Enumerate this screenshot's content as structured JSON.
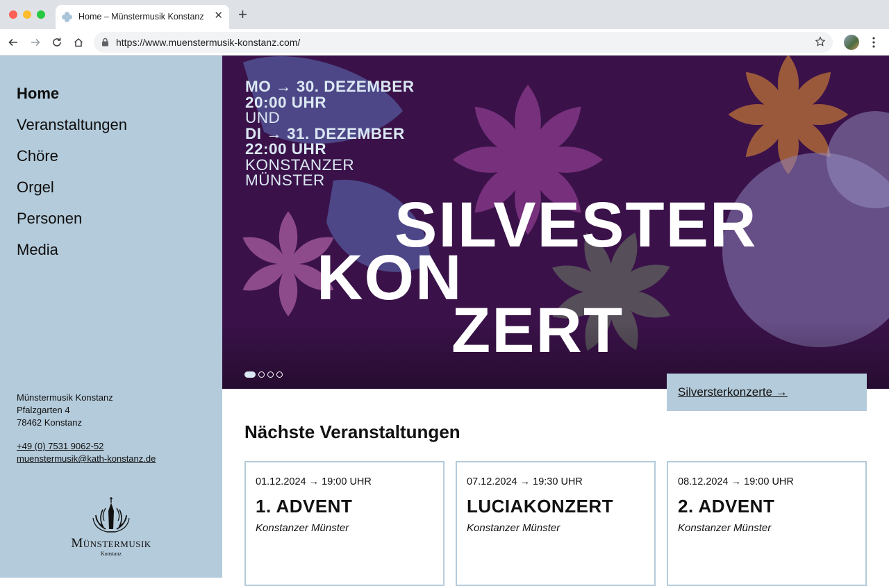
{
  "browser": {
    "tab_title": "Home – Münstermusik Konstanz",
    "url": "https://www.muenstermusik-konstanz.com/"
  },
  "sidebar": {
    "nav": [
      {
        "label": "Home",
        "active": true
      },
      {
        "label": "Veranstaltungen",
        "active": false
      },
      {
        "label": "Chöre",
        "active": false
      },
      {
        "label": "Orgel",
        "active": false
      },
      {
        "label": "Personen",
        "active": false
      },
      {
        "label": "Media",
        "active": false
      }
    ],
    "address": [
      "Münstermusik Konstanz",
      "Pfalzgarten 4",
      "78462 Konstanz"
    ],
    "phone": "+49 (0) 7531 9062-52",
    "email": "muenstermusik@kath-konstanz.de",
    "logo_word": "Münstermusik",
    "logo_sub": "Konstanz"
  },
  "hero": {
    "date_line_1": "MO → 30. DEZEMBER",
    "time_line_1": "20:00 UHR",
    "and": "UND",
    "date_line_2": "DI → 31. DEZEMBER",
    "time_line_2": "22:00 UHR",
    "venue_1": "KONSTANZER",
    "venue_2": "MÜNSTER",
    "title_1": "SILVESTER",
    "title_2": "KON",
    "title_3": "ZERT",
    "slide_count": 4,
    "active_slide": 1,
    "cta": "Silversterkonzerte →"
  },
  "events": {
    "heading": "Nächste Veranstaltungen",
    "items": [
      {
        "date": "01.12.2024 → 19:00 UHR",
        "title": "1. ADVENT",
        "place": "Konstanzer Münster"
      },
      {
        "date": "07.12.2024 → 19:30 UHR",
        "title": "LUCIAKONZERT",
        "place": "Konstanzer Münster"
      },
      {
        "date": "08.12.2024 → 19:00 UHR",
        "title": "2. ADVENT",
        "place": "Konstanzer Münster"
      }
    ]
  },
  "colors": {
    "sidebar_bg": "#b4cbdb",
    "hero_bg": "#3a1249",
    "card_border": "#b4cbdb"
  }
}
